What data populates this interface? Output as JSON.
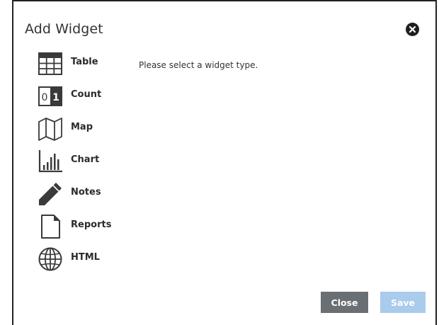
{
  "dialog": {
    "title": "Add Widget",
    "close_icon": "close-circle-icon",
    "prompt": "Please select a widget type."
  },
  "widget_types": [
    {
      "label": "Table",
      "icon": "table-icon"
    },
    {
      "label": "Count",
      "icon": "count-icon",
      "icon_text": [
        "0",
        "1"
      ]
    },
    {
      "label": "Map",
      "icon": "map-icon"
    },
    {
      "label": "Chart",
      "icon": "chart-icon"
    },
    {
      "label": "Notes",
      "icon": "pencil-icon"
    },
    {
      "label": "Reports",
      "icon": "document-icon"
    },
    {
      "label": "HTML",
      "icon": "globe-icon"
    }
  ],
  "footer": {
    "close_label": "Close",
    "save_label": "Save"
  },
  "colors": {
    "close_button": "#6a6f74",
    "save_button_disabled": "#a9cbec",
    "icon": "#3a3a3a"
  }
}
